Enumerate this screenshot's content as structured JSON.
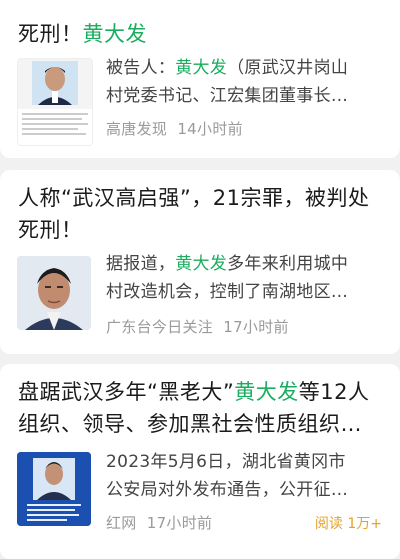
{
  "results": [
    {
      "title_pre": "死刑！",
      "title_hl": "黄大发",
      "title_post": "",
      "snippet_line1_pre": "被告人：",
      "snippet_line1_hl": "黄大发",
      "snippet_line1_post": "（原武汉井岗山",
      "snippet_line2": "村党委书记、江宏集团董事长…",
      "source": "高唐发现",
      "time": "14小时前",
      "thumb_caption": "黄大发 男 汉族 1964年12月17日出生，2013年被提名为全国劳动模范"
    },
    {
      "title_line1": "人称“武汉高启强”，21宗罪，被判处",
      "title_line2": "死刑！",
      "snippet_line1_pre": "据报道，",
      "snippet_line1_hl": "黄大发",
      "snippet_line1_post": "多年来利用城中",
      "snippet_line2": "村改造机会，控制了南湖地区…",
      "source": "广东台今日关注",
      "time": "17小时前"
    },
    {
      "title_line1_pre": "盘踞武汉多年“黑老大”",
      "title_line1_hl": "黄大发",
      "title_line1_post": "等12人",
      "title_line2": "组织、领导、参加黑社会性质组织…",
      "snippet_line1": "2023年5月6日，湖北省黄冈市",
      "snippet_line2": "公安局对外发布通告，公开征…",
      "source": "红网",
      "time": "17小时前",
      "reads": "阅读 1万+",
      "thumb_caption": "黄大发 男 汉族"
    }
  ],
  "colors": {
    "highlight": "#1aad5f",
    "reads": "#e5a128",
    "meta": "#9a9a9a",
    "poster_blue": "#1b4fb0"
  }
}
